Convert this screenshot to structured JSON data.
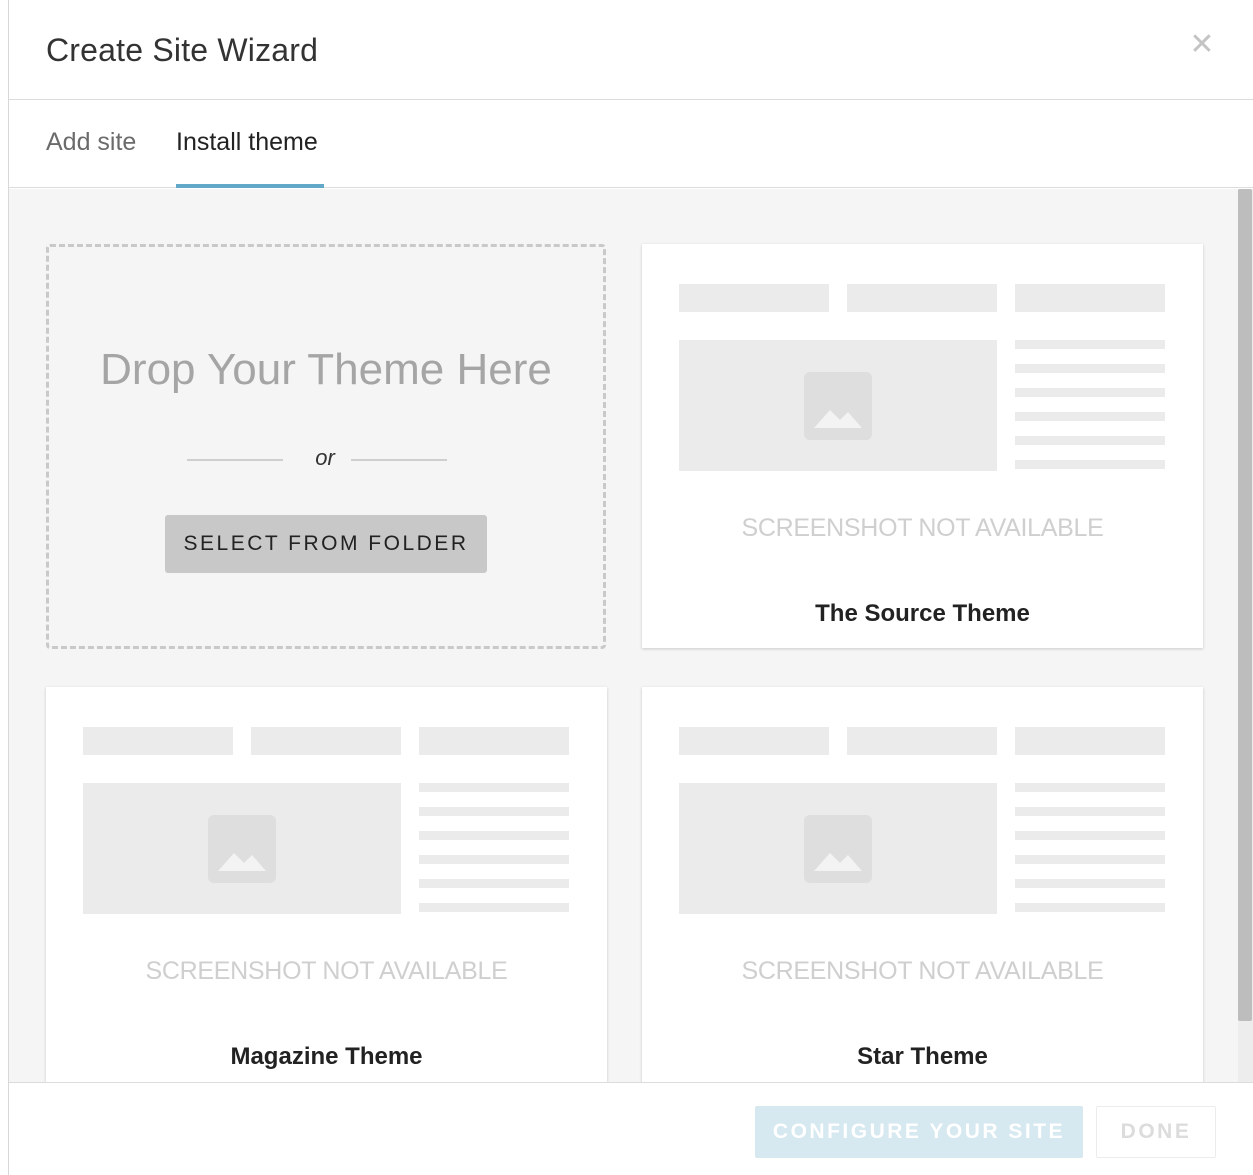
{
  "dialog": {
    "title": "Create Site Wizard",
    "close_icon": "close-icon"
  },
  "tabs": [
    {
      "label": "Add site",
      "active": false
    },
    {
      "label": "Install theme",
      "active": true
    }
  ],
  "accent_color": "#62a8c9",
  "dropzone": {
    "title": "Drop Your Theme Here",
    "or_text": "or",
    "select_button": "SELECT FROM FOLDER"
  },
  "themes": [
    {
      "name": "The Source Theme",
      "screenshot_text": "SCREENSHOT NOT AVAILABLE",
      "icon": "image-placeholder-icon"
    },
    {
      "name": "Magazine Theme",
      "screenshot_text": "SCREENSHOT NOT AVAILABLE",
      "icon": "image-placeholder-icon"
    },
    {
      "name": "Star Theme",
      "screenshot_text": "SCREENSHOT NOT AVAILABLE",
      "icon": "image-placeholder-icon"
    }
  ],
  "footer": {
    "configure_button": "CONFIGURE YOUR SITE",
    "done_button": "DONE"
  }
}
